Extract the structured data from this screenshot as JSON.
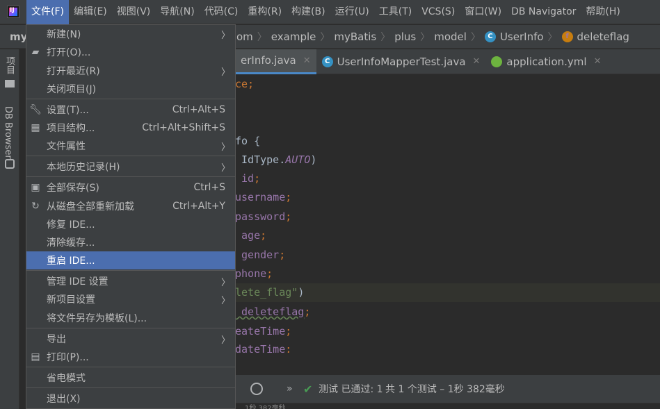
{
  "menubar": {
    "items": [
      "文件(F)",
      "编辑(E)",
      "视图(V)",
      "导航(N)",
      "代码(C)",
      "重构(R)",
      "构建(B)",
      "运行(U)",
      "工具(T)",
      "VCS(S)",
      "窗口(W)",
      "DB Navigator",
      "帮助(H)"
    ]
  },
  "navbar": {
    "project": "my",
    "crumbs": [
      "om",
      "example",
      "myBatis",
      "plus",
      "model",
      "UserInfo",
      "deleteflag"
    ]
  },
  "leftstrip": {
    "project_tab": "项目",
    "db_tab": "DB Browser"
  },
  "tabs": [
    {
      "label": "erInfo.java",
      "active": true
    },
    {
      "label": "UserInfoMapperTest.java",
      "active": false
    },
    {
      "label": "application.yml",
      "active": false
    }
  ],
  "code": {
    "l1": "ce;",
    "l4a": "fo {",
    "l5a": " IdType.",
    "l5b": "AUTO",
    "l5c": ")",
    "l6": " id",
    "l7": "username",
    "l8": "password",
    "l9": " age",
    "l10": " gender",
    "l11": "phone",
    "l12a": "lete_flag\"",
    "l12b": ")",
    "l13": " deleteflag",
    "l14": "eateTime",
    "l15": "dateTime",
    "semi": ";"
  },
  "runbar": {
    "more": "»",
    "label": "测试 已通过: 1",
    "detail": "共 1 个测试 – 1秒 382毫秒"
  },
  "status": {
    "time": "1秒 382毫秒"
  },
  "file_menu": {
    "items": [
      {
        "label": "新建(N)",
        "shortcut": "",
        "submenu": true,
        "icon": ""
      },
      {
        "label": "打开(O)...",
        "shortcut": "",
        "submenu": false,
        "icon": "folder-open-icon"
      },
      {
        "label": "打开最近(R)",
        "shortcut": "",
        "submenu": true,
        "icon": ""
      },
      {
        "label": "关闭项目(J)",
        "shortcut": "",
        "submenu": false,
        "icon": ""
      },
      {
        "label": "设置(T)...",
        "shortcut": "Ctrl+Alt+S",
        "submenu": false,
        "icon": "wrench-icon"
      },
      {
        "label": "项目结构...",
        "shortcut": "Ctrl+Alt+Shift+S",
        "submenu": false,
        "icon": "project-structure-icon"
      },
      {
        "label": "文件属性",
        "shortcut": "",
        "submenu": true,
        "icon": ""
      },
      {
        "label": "本地历史记录(H)",
        "shortcut": "",
        "submenu": true,
        "icon": ""
      },
      {
        "label": "全部保存(S)",
        "shortcut": "Ctrl+S",
        "submenu": false,
        "icon": "save-icon"
      },
      {
        "label": "从磁盘全部重新加载",
        "shortcut": "Ctrl+Alt+Y",
        "submenu": false,
        "icon": "reload-icon"
      },
      {
        "label": "修复 IDE...",
        "shortcut": "",
        "submenu": false,
        "icon": ""
      },
      {
        "label": "清除缓存...",
        "shortcut": "",
        "submenu": false,
        "icon": ""
      },
      {
        "label": "重启 IDE...",
        "shortcut": "",
        "submenu": false,
        "icon": "",
        "selected": true
      },
      {
        "label": "管理 IDE 设置",
        "shortcut": "",
        "submenu": true,
        "icon": ""
      },
      {
        "label": "新项目设置",
        "shortcut": "",
        "submenu": true,
        "icon": ""
      },
      {
        "label": "将文件另存为模板(L)...",
        "shortcut": "",
        "submenu": false,
        "icon": ""
      },
      {
        "label": "导出",
        "shortcut": "",
        "submenu": true,
        "icon": ""
      },
      {
        "label": "打印(P)...",
        "shortcut": "",
        "submenu": false,
        "icon": "print-icon"
      },
      {
        "label": "省电模式",
        "shortcut": "",
        "submenu": false,
        "icon": ""
      },
      {
        "label": "退出(X)",
        "shortcut": "",
        "submenu": false,
        "icon": ""
      }
    ]
  }
}
